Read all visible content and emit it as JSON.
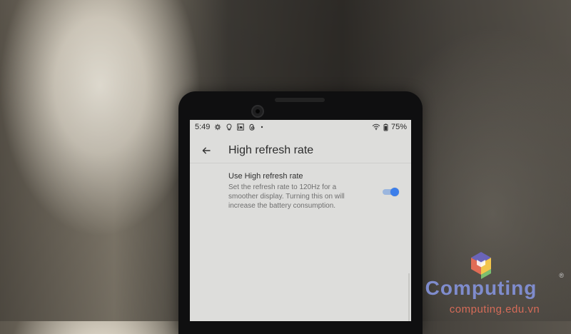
{
  "status_bar": {
    "time": "5:49",
    "battery": "75%"
  },
  "screen": {
    "title": "High refresh rate",
    "setting": {
      "title": "Use High refresh rate",
      "description": "Set the refresh rate to 120Hz for a smoother display. Turning this on will increase the battery consumption.",
      "enabled": true
    }
  },
  "watermark": {
    "brand": "Computing",
    "registered": "®",
    "website": "computing.edu.vn"
  },
  "colors": {
    "toggle_on": "#3c7eea",
    "toggle_track": "#9bb6de",
    "logo_blue": "#7f8ccd",
    "logo_red": "#d56b58"
  },
  "icons": {
    "status_left": [
      "settings-icon",
      "lightbulb-icon",
      "linkedin-icon",
      "threads-icon",
      "dot-icon"
    ],
    "status_right": [
      "wifi-icon",
      "battery-icon"
    ],
    "appbar": [
      "back-arrow-icon"
    ]
  }
}
